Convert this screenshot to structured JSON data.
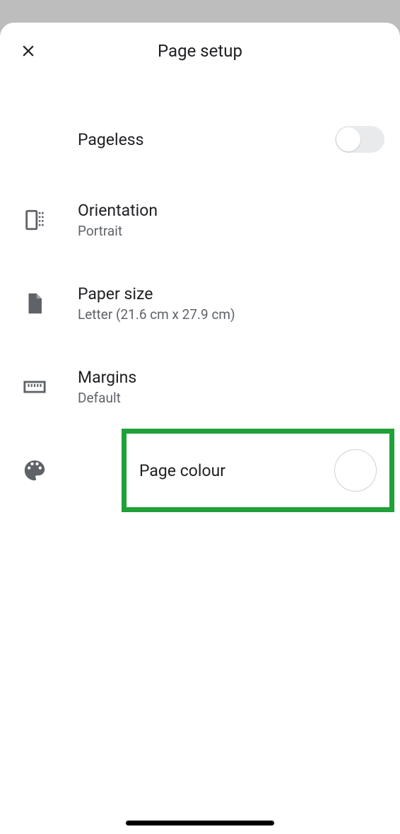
{
  "header": {
    "title": "Page setup"
  },
  "pageless": {
    "label": "Pageless",
    "enabled": false
  },
  "orientation": {
    "label": "Orientation",
    "value": "Portrait"
  },
  "paperSize": {
    "label": "Paper size",
    "value": "Letter (21.6 cm x 27.9 cm)"
  },
  "margins": {
    "label": "Margins",
    "value": "Default"
  },
  "pageColour": {
    "label": "Page colour",
    "value": "#ffffff"
  }
}
